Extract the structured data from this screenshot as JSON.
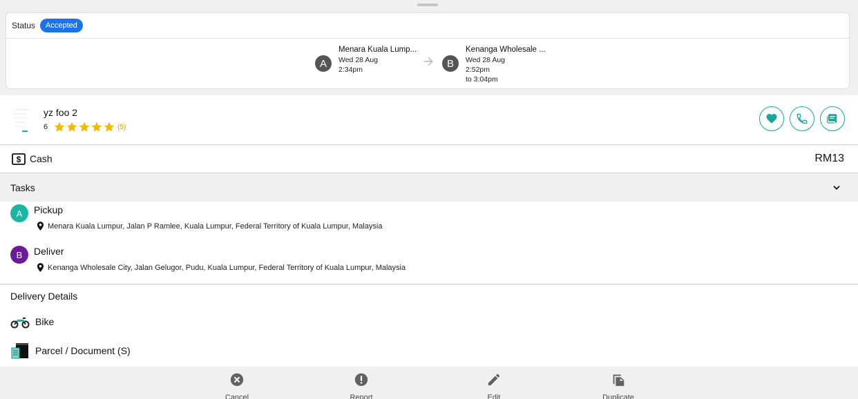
{
  "status": {
    "label": "Status",
    "badge": "Accepted",
    "badge_color": "#1a73e8"
  },
  "route": {
    "from": {
      "letter": "A",
      "name": "Menara Kuala Lump...",
      "date": "Wed 28 Aug",
      "time": "2:34pm"
    },
    "to": {
      "letter": "B",
      "name": "Kenanga Wholesale ...",
      "date": "Wed 28 Aug",
      "time": "2:52pm",
      "time_end": "to 3:04pm"
    }
  },
  "driver": {
    "name": "yz foo 2",
    "count": "6",
    "rating": 5,
    "rating_count": "(5)",
    "actions": [
      "heart-icon",
      "phone-icon",
      "chat-icon"
    ],
    "accent_color": "#1aa79a"
  },
  "payment": {
    "method": "Cash",
    "amount": "RM13"
  },
  "tasks": {
    "title": "Tasks",
    "items": [
      {
        "letter": "A",
        "title": "Pickup",
        "address": "Menara Kuala Lumpur, Jalan P Ramlee, Kuala Lumpur, Federal Territory of Kuala Lumpur, Malaysia",
        "color": "#1ab5a3"
      },
      {
        "letter": "B",
        "title": "Deliver",
        "address": "Kenanga Wholesale City, Jalan Gelugor, Pudu, Kuala Lumpur, Federal Territory of Kuala Lumpur, Malaysia",
        "color": "#6a1b9a"
      }
    ]
  },
  "delivery_details": {
    "title": "Delivery Details",
    "vehicle": "Bike",
    "package": "Parcel / Document (S)"
  },
  "footer": {
    "cancel": "Cancel",
    "report": "Report",
    "edit": "Edit",
    "duplicate": "Duplicate"
  }
}
